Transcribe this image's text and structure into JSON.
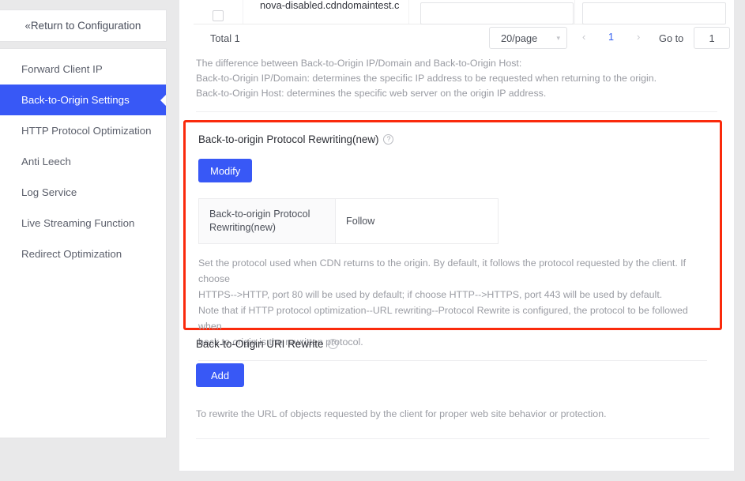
{
  "sidebar": {
    "return_button": {
      "label": "Return to Configuration",
      "icon": "double-chevron-left-icon",
      "glyph": "«"
    },
    "items": [
      {
        "label": "Forward Client IP",
        "active": false
      },
      {
        "label": "Back-to-Origin Settings",
        "active": true
      },
      {
        "label": "HTTP Protocol Optimization",
        "active": false
      },
      {
        "label": "Anti Leech",
        "active": false
      },
      {
        "label": "Log Service",
        "active": false
      },
      {
        "label": "Live Streaming Function",
        "active": false
      },
      {
        "label": "Redirect Optimization",
        "active": false
      }
    ]
  },
  "table_fragment": {
    "domain": "nova-disabled.cdndomaintest.c",
    "input_a_value": "",
    "input_b_value": "",
    "checkbox_checked": false
  },
  "pagination": {
    "total_label": "Total 1",
    "page_size": "20/page",
    "page_size_caret": "⌄",
    "prev_arrow": "‹",
    "next_arrow": "›",
    "current_page": "1",
    "goto_label": "Go to",
    "goto_value": "1"
  },
  "origin_note": {
    "line1": "The difference between Back-to-Origin IP/Domain and Back-to-Origin Host:",
    "line2": "Back-to-Origin IP/Domain: determines the specific IP address to be requested when returning to the origin.",
    "line3": "Back-to-Origin Host: determines the specific web server on the origin IP address."
  },
  "protocol_rewriting": {
    "title": "Back-to-origin Protocol Rewriting(new)",
    "help_icon": "question-circle-icon",
    "help_glyph": "?",
    "modify_button": "Modify",
    "table": {
      "key": "Back-to-origin Protocol Rewriting(new)",
      "value": "Follow"
    },
    "description_line1": "Set the protocol used when CDN returns to the origin. By default, it follows the protocol requested by the client. If choose",
    "description_line2": "HTTPS-->HTTP, port 80 will be used by default; if choose HTTP-->HTTPS, port 443 will be used by default.",
    "description_line3": "Note that if HTTP protocol optimization--URL rewriting--Protocol Rewrite is configured, the protocol to be followed when",
    "description_line4": "back to origin is the rewritten protocol."
  },
  "uri_rewrite": {
    "title": "Back-to-Origin URI Rewrite",
    "help_icon": "question-circle-icon",
    "help_glyph": "?",
    "add_button": "Add",
    "description": "To rewrite the URL of objects requested by the client for proper web site behavior or protection."
  },
  "colors": {
    "accent_blue": "#3858f6",
    "link_blue": "#2f5cf0",
    "highlight_red": "#fa2a0c",
    "page_background": "#e9e9ea",
    "panel_background": "#ffffff"
  }
}
